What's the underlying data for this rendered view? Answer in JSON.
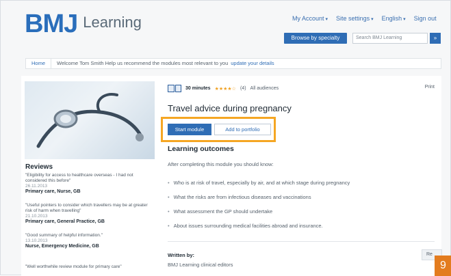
{
  "brand": {
    "logo_text": "BMJ",
    "product": "Learning",
    "accent": "#2a6ebb"
  },
  "topnav": {
    "my_account": "My Account",
    "site_settings": "Site settings",
    "language": "English",
    "sign_out": "Sign out"
  },
  "header": {
    "browse_label": "Browse by specialty",
    "search_placeholder": "Search BMJ Learning",
    "search_go": "»"
  },
  "welcome": {
    "home_tab": "Home",
    "text": "Welcome Tom Smith    Help us recommend the modules most relevant to you",
    "link": "update your details"
  },
  "module": {
    "duration": "30 minutes",
    "stars": "★★★★☆",
    "rating_count": "(4)",
    "audience": "All audiences",
    "print": "Print",
    "title": "Travel advice during pregnancy",
    "start_label": "Start module",
    "portfolio_label": "Add to portfolio"
  },
  "outcomes": {
    "title": "Learning outcomes",
    "intro": "After completing this module you should know:",
    "items": [
      "Who is at risk of travel, especially by air, and at which stage during pregnancy",
      "What the risks are from infectious diseases and vaccinations",
      "What assessment the GP should undertake",
      "About issues surrounding medical facilities abroad and insurance."
    ]
  },
  "reviews": {
    "title": "Reviews",
    "items": [
      {
        "quote": "\"Eligibility for access to healthcare overseas - I had not considered this before\"",
        "date": "26.11.2013",
        "author": "Primary care, Nurse, GB"
      },
      {
        "quote": "\"Useful pointers to consider which travellers may be at greater risk of harm when travelling\"",
        "date": "21.10.2013",
        "author": "Primary care, General Practice, GB"
      },
      {
        "quote": "\"Good summary of helpful information.\"",
        "date": "13.10.2013",
        "author": "Nurse, Emergency Medicine, GB"
      },
      {
        "quote": "\"Well worthwhile review module for primary care\"",
        "date": "",
        "author": ""
      }
    ]
  },
  "footer": {
    "written_by": "Written by:",
    "writers": "BMJ Learning clinical editors",
    "corner_label": "Re",
    "page_number": "9"
  },
  "colors": {
    "highlight": "#f5a623",
    "page_badge": "#e37c1f",
    "button": "#2f6db5"
  }
}
